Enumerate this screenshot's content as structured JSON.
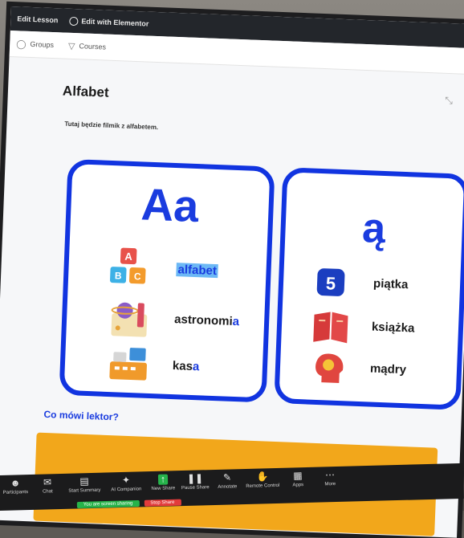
{
  "adminbar": {
    "edit_lesson": "Edit Lesson",
    "edit_elementor": "Edit with Elementor"
  },
  "subnav": {
    "groups": "Groups",
    "courses": "Courses"
  },
  "lesson": {
    "title": "Alfabet",
    "description": "Tutaj będzie filmik z alfabetem."
  },
  "card_left": {
    "letter": "Aa",
    "words": [
      {
        "text": "alfabet",
        "picture": "alphabet-blocks-icon"
      },
      {
        "pre": "astronomi",
        "accent": "a",
        "picture": "astronomy-icon"
      },
      {
        "pre": "kas",
        "accent": "a",
        "picture": "cash-register-icon"
      }
    ]
  },
  "card_right": {
    "letter": "ą",
    "number_badge": "5",
    "words": [
      {
        "text": "piątka",
        "picture": "number-five-icon"
      },
      {
        "text": "książka",
        "picture": "book-icon"
      },
      {
        "text": "mądry",
        "picture": "smart-head-icon"
      }
    ]
  },
  "section": {
    "heading": "Co mówi lektor?"
  },
  "zoom_toolbar": {
    "items": [
      {
        "label": "Participants",
        "icon": "people-icon"
      },
      {
        "label": "Chat",
        "icon": "chat-icon"
      },
      {
        "label": "Start Summary",
        "icon": "summary-icon"
      },
      {
        "label": "AI Companion",
        "icon": "ai-icon"
      },
      {
        "label": "New Share",
        "icon": "share-icon"
      },
      {
        "label": "Pause Share",
        "icon": "pause-icon"
      },
      {
        "label": "Annotate",
        "icon": "annotate-icon"
      },
      {
        "label": "Remote Control",
        "icon": "remote-icon"
      },
      {
        "label": "Apps",
        "icon": "apps-icon"
      },
      {
        "label": "More",
        "icon": "more-icon"
      }
    ],
    "share_status": "You are screen sharing",
    "stop_share": "Stop Share"
  },
  "colors": {
    "card_border": "#1134e0",
    "accent_blue": "#1a3cdf",
    "orange_panel": "#f2a71b",
    "zoom_green": "#26b34b",
    "stop_red": "#e23b3b"
  }
}
